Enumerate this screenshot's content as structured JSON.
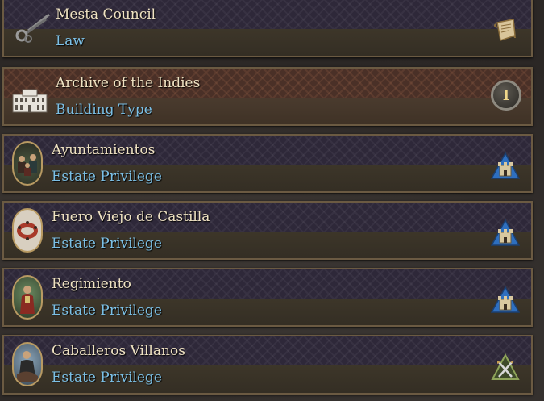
{
  "items": [
    {
      "title": "Mesta Council",
      "type": "Law",
      "icon": "shears-icon",
      "action_icon": "scroll-icon"
    },
    {
      "title": "Archive of the Indies",
      "type": "Building Type",
      "icon": "palace-icon",
      "action_icon": "roman-numeral-badge-icon",
      "badge": "I"
    },
    {
      "title": "Ayuntamientos",
      "type": "Estate Privilege",
      "icon": "council-portrait-icon",
      "action_icon": "burghers-estate-icon"
    },
    {
      "title": "Fuero Viejo de Castilla",
      "type": "Estate Privilege",
      "icon": "round-table-portrait-icon",
      "action_icon": "burghers-estate-icon"
    },
    {
      "title": "Regimiento",
      "type": "Estate Privilege",
      "icon": "official-portrait-icon",
      "action_icon": "burghers-estate-icon"
    },
    {
      "title": "Caballeros Villanos",
      "type": "Estate Privilege",
      "icon": "knight-portrait-icon",
      "action_icon": "crossed-swords-estate-icon"
    }
  ],
  "colors": {
    "title": "#efe2c2",
    "subtitle": "#7cc0e6",
    "frame": "#6b5a42",
    "burghers_blue": "#2e6fbf"
  }
}
